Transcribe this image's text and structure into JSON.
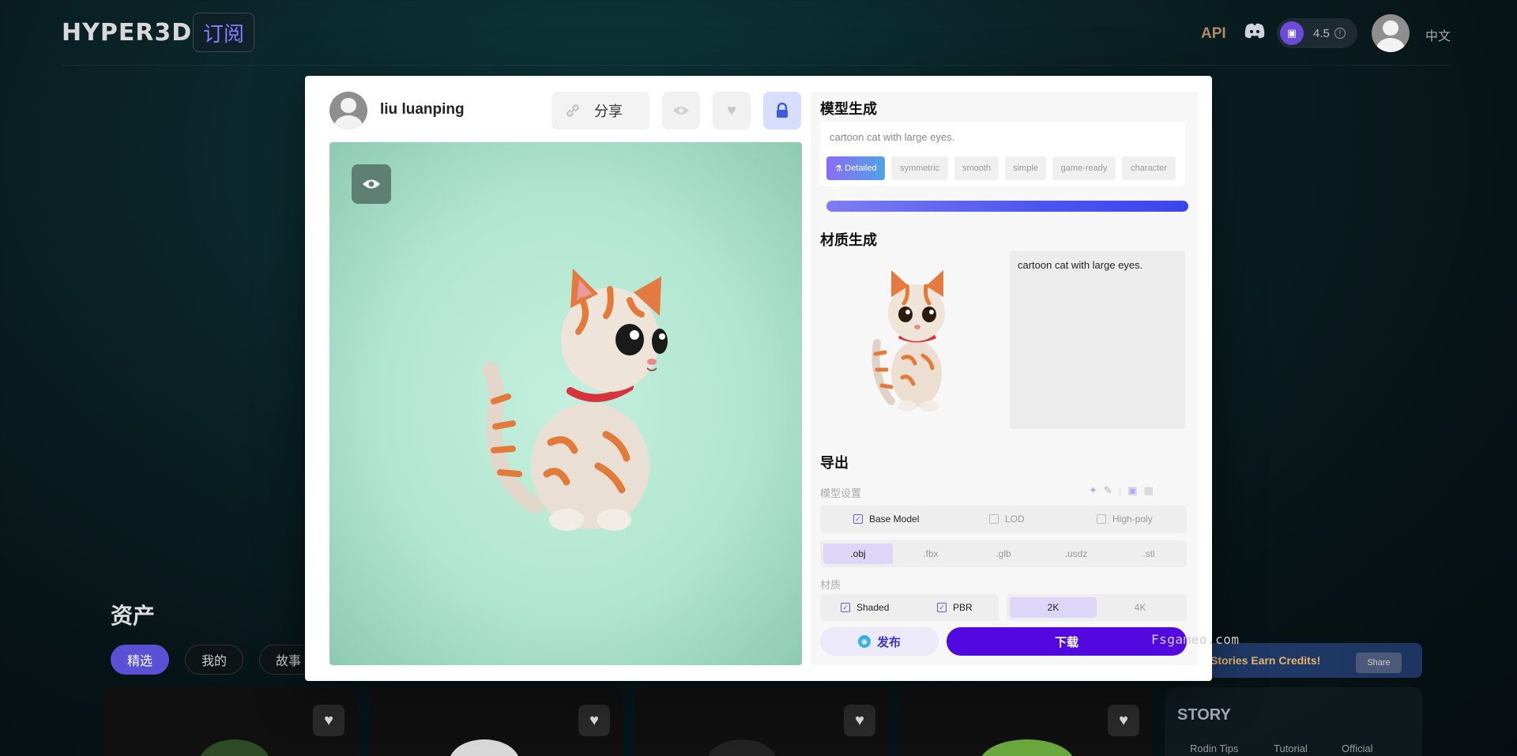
{
  "header": {
    "logo": "HYPER3D",
    "subscribe_label": "订阅",
    "api_label": "API",
    "credits": "4.5",
    "language": "中文",
    "icons": [
      "discord-icon",
      "wallet-icon",
      "info-icon",
      "user-avatar"
    ]
  },
  "assets": {
    "title": "资产",
    "filters": [
      "精选",
      "我的",
      "故事"
    ],
    "active_filter": "精选"
  },
  "stories_banner": {
    "text": "Stories Earn Credits!",
    "chip": "Share"
  },
  "story": {
    "title": "STORY",
    "tabs": [
      "Rodin Tips",
      "Tutorial",
      "Official"
    ]
  },
  "watermark": "Fsgameo.com",
  "modal": {
    "user_name": "liu luanping",
    "share_label": "分享",
    "model_gen": {
      "title": "模型生成",
      "prompt": "cartoon cat with large eyes.",
      "tags": [
        "Detailed",
        "symmetric",
        "smooth",
        "simple",
        "game-ready",
        "character"
      ],
      "active_tag": "Detailed",
      "progress": 1.0
    },
    "texture_gen": {
      "title": "材质生成",
      "prompt": "cartoon cat with large eyes."
    },
    "export": {
      "title": "导出",
      "model_settings_label": "模型设置",
      "model_options": [
        {
          "label": "Base Model",
          "checked": true
        },
        {
          "label": "LOD",
          "checked": false
        },
        {
          "label": "High-poly",
          "checked": false
        }
      ],
      "formats": [
        ".obj",
        ".fbx",
        ".glb",
        ".usdz",
        ".stl"
      ],
      "active_format": ".obj",
      "material_label": "材质",
      "material_options": [
        {
          "label": "Shaded",
          "checked": true
        },
        {
          "label": "PBR",
          "checked": true
        }
      ],
      "resolutions": [
        "2K",
        "4K"
      ],
      "active_resolution": "2K"
    },
    "publish_label": "发布",
    "download_label": "下载"
  },
  "colors": {
    "accent": "#5209e0",
    "lock_bg": "#d8deff",
    "viewer_bg": "#b8ead5",
    "progress": "#4a55f0"
  }
}
